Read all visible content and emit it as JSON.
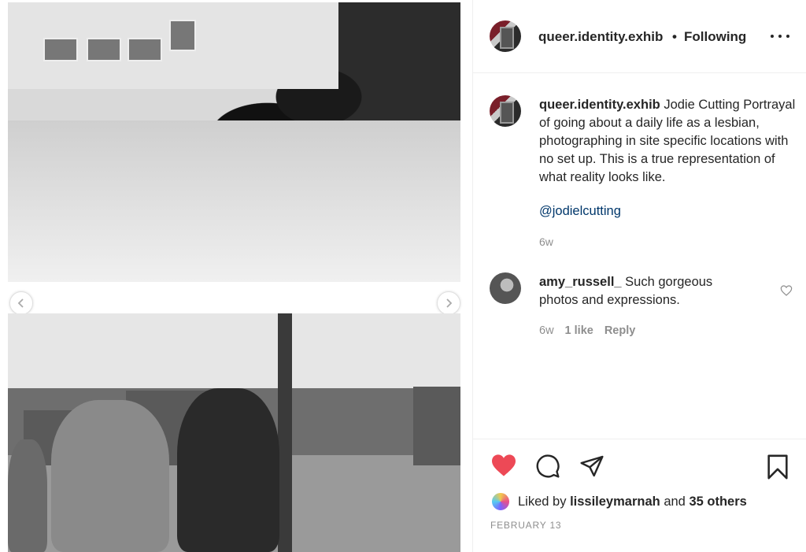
{
  "post": {
    "username": "queer.identity.exhib",
    "separator": "•",
    "follow_status": "Following",
    "caption_username": "queer.identity.exhib",
    "caption_text": "Jodie Cutting Portrayal of going about a daily life as a lesbian, photographing in site specific locations with no set up. This is a true representation of what reality looks like.",
    "mention": "@jodielcutting",
    "caption_time": "6w",
    "comments": [
      {
        "username": "amy_russell_",
        "text": "Such gorgeous photos and expressions.",
        "time": "6w",
        "likes": "1 like",
        "reply": "Reply"
      }
    ],
    "liked_by_prefix": "Liked by",
    "liked_by_user": "lissileymarnah",
    "liked_by_and": "and",
    "liked_by_others": "35 others",
    "date": "FEBRUARY 13"
  },
  "icons": {
    "more": "more-options-icon",
    "like": "heart-filled-icon",
    "comment": "comment-icon",
    "share": "share-icon",
    "save": "bookmark-icon",
    "prev": "chevron-left-icon",
    "next": "chevron-right-icon"
  },
  "colors": {
    "like_red": "#ed4956",
    "link_blue": "#00376b",
    "muted_gray": "#8e8e8e",
    "text_dark": "#262626"
  }
}
